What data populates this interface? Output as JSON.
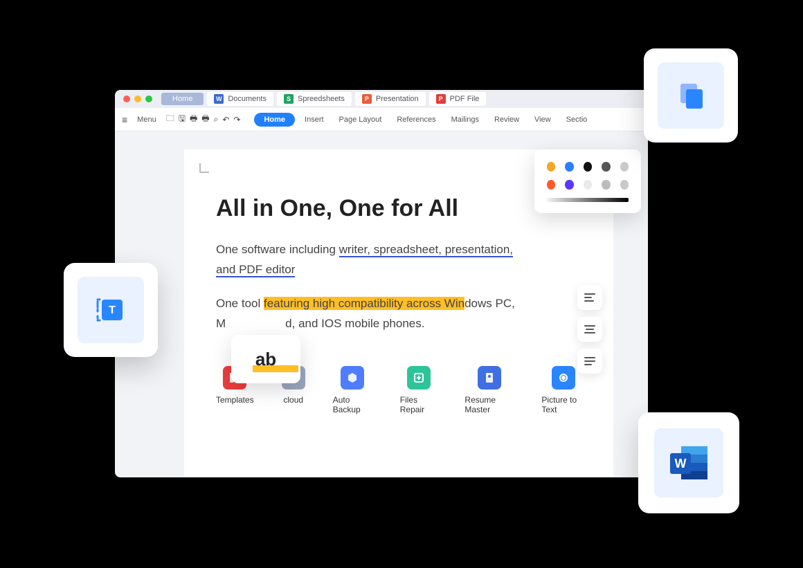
{
  "tabs": {
    "home": "Home",
    "docs": "Documents",
    "sheets": "Spreedsheets",
    "pres": "Presentation",
    "pdf": "PDF File"
  },
  "toolbar": {
    "menu": "Menu",
    "ribbon": {
      "home": "Home",
      "insert": "Insert",
      "pagelayout": "Page Layout",
      "references": "References",
      "mailings": "Mailings",
      "review": "Review",
      "view": "View",
      "sections": "Sectio"
    }
  },
  "document": {
    "title": "All in One, One for All",
    "p1_a": "One software including ",
    "p1_b": "writer, spreadsheet, presentation,",
    "p1_c": "and PDF editor",
    "p2_a": "One tool ",
    "p2_b": "featuring high compatibility across Win",
    "p2_c": "dows PC,",
    "p2_d": "M",
    "p2_e": "d, and IOS mobile phones."
  },
  "features": {
    "templates": "Templates",
    "cloud": "cloud",
    "autobackup": "Auto Backup",
    "filesrepair": "Files Repair",
    "resumemaster": "Resume Master",
    "ptt": "Picture to Text"
  },
  "ab": "ab",
  "palette": {
    "row1": [
      "#f5a623",
      "#2a7fff",
      "#111",
      "#555",
      "#c9c9c9"
    ],
    "row2": [
      "#ff5a2c",
      "#5a36ff",
      "#eaeaea",
      "#bdbdbd",
      "#c9c9c9"
    ]
  }
}
